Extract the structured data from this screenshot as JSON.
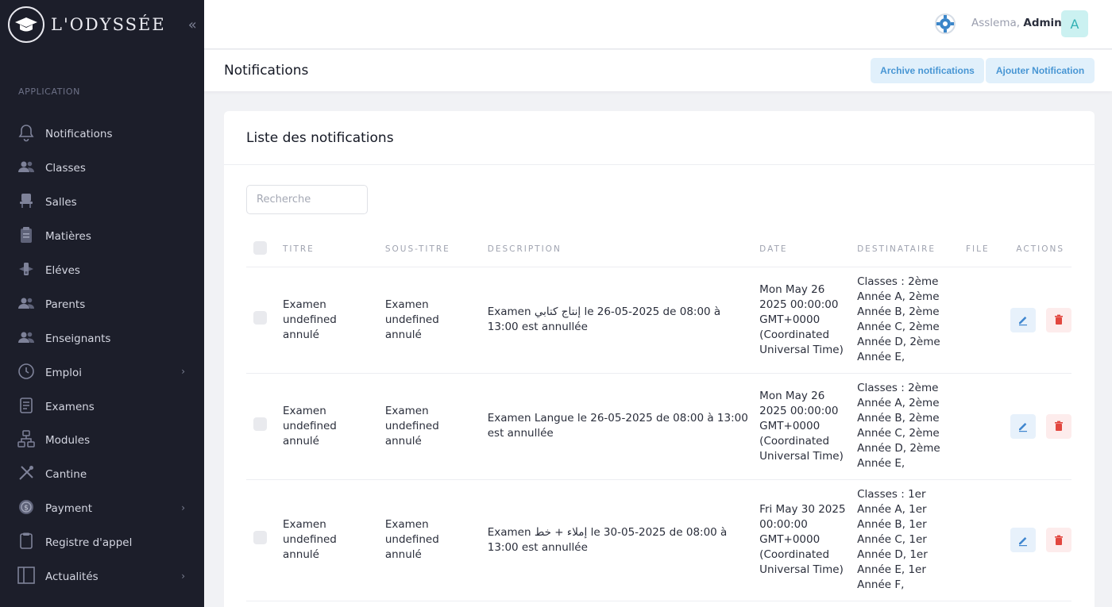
{
  "brand": {
    "name": "L'ODYSSÉE"
  },
  "sidebar": {
    "section_label": "APPLICATION",
    "items": [
      {
        "label": "Notifications",
        "icon": "bell-icon",
        "has_submenu": false
      },
      {
        "label": "Classes",
        "icon": "users-icon",
        "has_submenu": false
      },
      {
        "label": "Salles",
        "icon": "chair-icon",
        "has_submenu": false
      },
      {
        "label": "Matières",
        "icon": "clipboard-icon",
        "has_submenu": false
      },
      {
        "label": "Eléves",
        "icon": "student-icon",
        "has_submenu": false
      },
      {
        "label": "Parents",
        "icon": "users-icon",
        "has_submenu": false
      },
      {
        "label": "Enseignants",
        "icon": "users-icon",
        "has_submenu": false
      },
      {
        "label": "Emploi",
        "icon": "clock-icon",
        "has_submenu": true
      },
      {
        "label": "Examens",
        "icon": "document-icon",
        "has_submenu": false
      },
      {
        "label": "Modules",
        "icon": "network-icon",
        "has_submenu": false
      },
      {
        "label": "Cantine",
        "icon": "utensils-icon",
        "has_submenu": false
      },
      {
        "label": "Payment",
        "icon": "coin-icon",
        "has_submenu": true
      },
      {
        "label": "Registre d'appel",
        "icon": "register-icon",
        "has_submenu": false
      },
      {
        "label": "Actualités",
        "icon": "columns-icon",
        "has_submenu": true
      }
    ]
  },
  "header": {
    "greeting": "Asslema,",
    "user": "Admin",
    "avatar_letter": "A",
    "language_icon": "globe-flag-icon"
  },
  "subheader": {
    "title": "Notifications",
    "archive_label": "Archive notifications",
    "add_label": "Ajouter Notification"
  },
  "card": {
    "title": "Liste des notifications",
    "search_placeholder": "Recherche"
  },
  "table": {
    "headers": [
      "TITRE",
      "SOUS-TITRE",
      "DESCRIPTION",
      "DATE",
      "DESTINATAIRE",
      "FILE",
      "ACTIONS"
    ],
    "rows": [
      {
        "titre": "Examen undefined annulé",
        "sous_titre": "Examen undefined annulé",
        "description": "Examen إنتاج كتابي le 26-05-2025 de 08:00 à 13:00 est annullée",
        "date": "Mon May 26 2025 00:00:00 GMT+0000 (Coordinated Universal Time)",
        "destinataire": "Classes : 2ème Année A, 2ème Année B, 2ème Année C, 2ème Année D, 2ème Année E,",
        "file": ""
      },
      {
        "titre": "Examen undefined annulé",
        "sous_titre": "Examen undefined annulé",
        "description": "Examen Langue le 26-05-2025 de 08:00 à 13:00 est annullée",
        "date": "Mon May 26 2025 00:00:00 GMT+0000 (Coordinated Universal Time)",
        "destinataire": "Classes : 2ème Année A, 2ème Année B, 2ème Année C, 2ème Année D, 2ème Année E,",
        "file": ""
      },
      {
        "titre": "Examen undefined annulé",
        "sous_titre": "Examen undefined annulé",
        "description": "Examen إملاء + خط le 30-05-2025 de 08:00 à 13:00 est annullée",
        "date": "Fri May 30 2025 00:00:00 GMT+0000 (Coordinated Universal Time)",
        "destinataire": "Classes : 1er Année A, 1er Année B, 1er Année C, 1er Année D, 1er Année E, 1er Année F,",
        "file": ""
      }
    ]
  },
  "colors": {
    "sidebar_bg": "#1c1e2a",
    "accent_blue": "#4896d4",
    "button_bg": "#e1f0fb",
    "delete_red": "#e2473f",
    "avatar_bg": "#cbf1f1"
  }
}
